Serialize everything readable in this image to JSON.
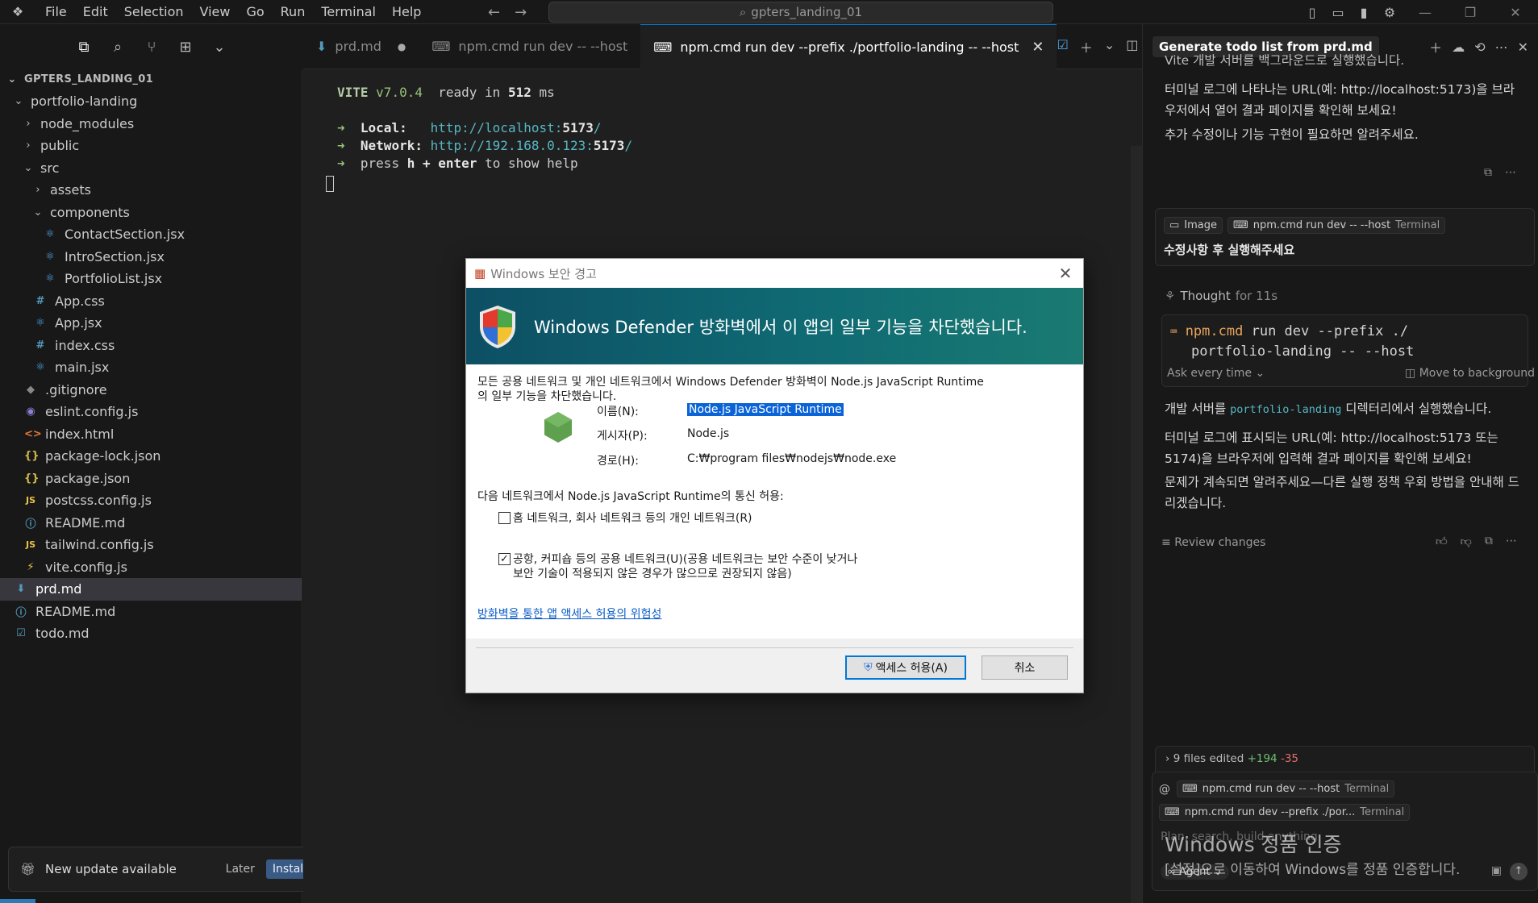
{
  "menu": [
    "File",
    "Edit",
    "Selection",
    "View",
    "Go",
    "Run",
    "Terminal",
    "Help"
  ],
  "search": {
    "text": "gpters_landing_01"
  },
  "explorer": {
    "root": "GPTERS_LANDING_01",
    "items": [
      {
        "label": "portfolio-landing",
        "depth": 1,
        "kind": "folder-open",
        "icon": "chevron-down-icon"
      },
      {
        "label": "node_modules",
        "depth": 2,
        "kind": "folder",
        "icon": "chevron-right-icon"
      },
      {
        "label": "public",
        "depth": 2,
        "kind": "folder",
        "icon": "chevron-right-icon"
      },
      {
        "label": "src",
        "depth": 2,
        "kind": "folder-open",
        "icon": "chevron-down-icon"
      },
      {
        "label": "assets",
        "depth": 3,
        "kind": "folder",
        "icon": "chevron-right-icon"
      },
      {
        "label": "components",
        "depth": 3,
        "kind": "folder-open",
        "icon": "chevron-down-icon"
      },
      {
        "label": "ContactSection.jsx",
        "depth": 4,
        "kind": "react"
      },
      {
        "label": "IntroSection.jsx",
        "depth": 4,
        "kind": "react"
      },
      {
        "label": "PortfolioList.jsx",
        "depth": 4,
        "kind": "react"
      },
      {
        "label": "App.css",
        "depth": 3,
        "kind": "css"
      },
      {
        "label": "App.jsx",
        "depth": 3,
        "kind": "react"
      },
      {
        "label": "index.css",
        "depth": 3,
        "kind": "css"
      },
      {
        "label": "main.jsx",
        "depth": 3,
        "kind": "react"
      },
      {
        "label": ".gitignore",
        "depth": 2,
        "kind": "git"
      },
      {
        "label": "eslint.config.js",
        "depth": 2,
        "kind": "eslint"
      },
      {
        "label": "index.html",
        "depth": 2,
        "kind": "html"
      },
      {
        "label": "package-lock.json",
        "depth": 2,
        "kind": "json"
      },
      {
        "label": "package.json",
        "depth": 2,
        "kind": "json"
      },
      {
        "label": "postcss.config.js",
        "depth": 2,
        "kind": "js"
      },
      {
        "label": "README.md",
        "depth": 2,
        "kind": "info"
      },
      {
        "label": "tailwind.config.js",
        "depth": 2,
        "kind": "js"
      },
      {
        "label": "vite.config.js",
        "depth": 2,
        "kind": "vite"
      },
      {
        "label": "prd.md",
        "depth": 1,
        "kind": "md",
        "selected": true
      },
      {
        "label": "README.md",
        "depth": 1,
        "kind": "info"
      },
      {
        "label": "todo.md",
        "depth": 1,
        "kind": "todo"
      }
    ]
  },
  "toast": {
    "message": "New update available",
    "later": "Later",
    "install": "Install Now"
  },
  "tabs": [
    {
      "label": "prd.md",
      "modified": true,
      "active": false
    },
    {
      "label": "npm.cmd run dev -- --host",
      "active": false
    },
    {
      "label": "npm.cmd run dev --prefix ./portfolio-landing -- --host",
      "active": true
    }
  ],
  "terminal": {
    "vite": "VITE",
    "version": "v7.0.4",
    "ready_pre": "ready in",
    "ready_ms": "512",
    "ready_unit": "ms",
    "arrow": "➜",
    "local_label": "Local:",
    "local_url_pre": "http://localhost:",
    "local_port": "5173",
    "local_url_post": "/",
    "network_label": "Network:",
    "network_url_pre": "http://192.168.0.123:",
    "network_port": "5173",
    "network_url_post": "/",
    "help_pre": "press",
    "help_key": "h + enter",
    "help_post": "to show help"
  },
  "dialog": {
    "title": "Windows 보안 경고",
    "headline": "Windows Defender 방화벽에서 이 앱의 일부 기능을 차단했습니다.",
    "desc_line1": "모든 공용 네트워크 및 개인 네트워크에서 Windows Defender 방화벽이 Node.js JavaScript Runtime",
    "desc_line2": "의 일부 기능을 차단했습니다.",
    "name_label": "이름(N):",
    "name_value": "Node.js JavaScript Runtime",
    "publisher_label": "게시자(P):",
    "publisher_value": "Node.js",
    "path_label": "경로(H):",
    "path_value": "C:₩program files₩nodejs₩node.exe",
    "allow_heading": "다음 네트워크에서 Node.js JavaScript Runtime의 통신 허용:",
    "private_option": "홈 네트워크, 회사 네트워크 등의 개인 네트워크(R)",
    "private_checked": false,
    "public_option_line1": "공항, 커피숍 등의 공용 네트워크(U)(공용 네트워크는 보안 수준이 낮거나",
    "public_option_line2": "보안 기술이 적용되지 않은 경우가 많으므로 권장되지 않음)",
    "public_checked": true,
    "risk_link": "방화벽을 통한 앱 액세스 허용의 위험성",
    "allow_button": "액세스 허용(A)",
    "cancel_button": "취소"
  },
  "chat": {
    "title": "Generate todo list from prd.md",
    "msg1_partial": "Vite 개발 서버를 백그라운드로 실행했습니다.",
    "msg1_p1": "터미널 로그에 나타나는 URL(예: http://localhost:5173)을 브라우저에서 열어 결과 페이지를 확인해 보세요!",
    "msg1_p2": "추가 수정이나 기능 구현이 필요하면 알려주세요.",
    "user_chip_image": "Image",
    "user_chip_terminal": "npm.cmd run dev -- --host",
    "user_chip_terminal_suffix": "Terminal",
    "user_message": "수정사항 후 실행해주세요",
    "thought_label": "Thought",
    "thought_time": "for 11s",
    "cmd_name": "npm.cmd",
    "cmd_rest_line1": "run dev --prefix ./",
    "cmd_line2": "portfolio-landing -- --host",
    "ask_label": "Ask every time",
    "move_bg": "Move to background",
    "msg2_pre": "개발 서버를",
    "msg2_code": "portfolio-landing",
    "msg2_post": "디렉터리에서 실행했습니다.",
    "msg2_p2": "터미널 로그에 표시되는 URL(예: http://localhost:5173 또는 5174)을 브라우저에 입력해 결과 페이지를 확인해 보세요!",
    "msg2_p3": "문제가 계속되면 알려주세요—다른 실행 정책 우회 방법을 안내해 드리겠습니다.",
    "review_changes": "Review changes",
    "files_edited": "9 files edited",
    "added": "+194",
    "removed": "-35",
    "ctx1": "npm.cmd run dev -- --host",
    "ctx1_suffix": "Terminal",
    "ctx2": "npm.cmd run dev --prefix ./por...",
    "ctx2_suffix": "Terminal",
    "input_placeholder": "Plan, search, build anything",
    "agent_label": "Agent"
  },
  "watermark": {
    "title": "Windows 정품 인증",
    "subtitle": "[설정]으로 이동하여 Windows를 정품 인증합니다."
  }
}
